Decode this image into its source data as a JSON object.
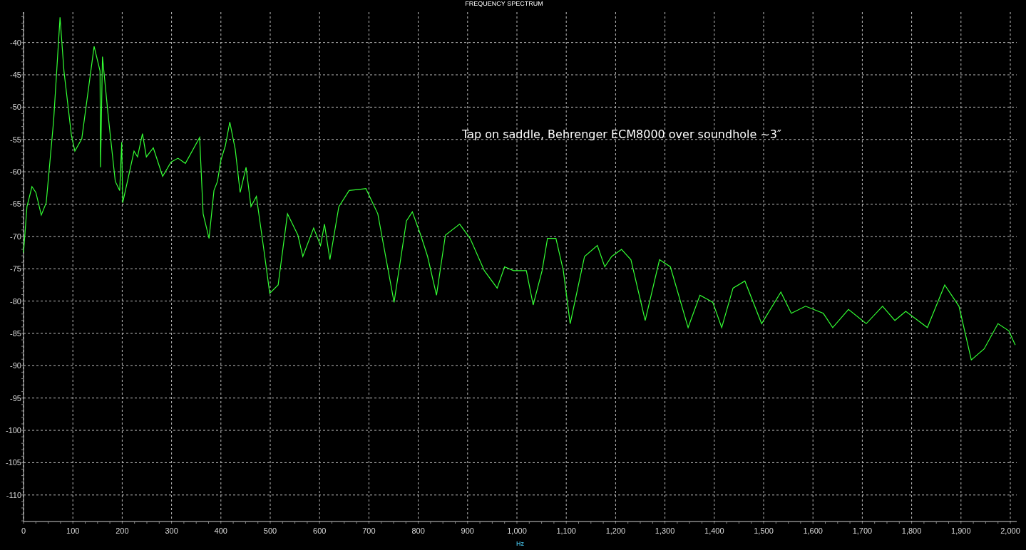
{
  "chart": {
    "chart_data": {
      "type": "line",
      "title": "FREQUENCY SPECTRUM",
      "xlabel": "Hz",
      "x": [
        0,
        7,
        17,
        25,
        36,
        46,
        61,
        74,
        82,
        97,
        104,
        118,
        143,
        155,
        156,
        160,
        172,
        186,
        195,
        199,
        201,
        212,
        224,
        231,
        241,
        249,
        263,
        282,
        299,
        313,
        328,
        357,
        364,
        376,
        386,
        393,
        400,
        409,
        418,
        429,
        439,
        451,
        461,
        472,
        487,
        499,
        516,
        535,
        556,
        566,
        588,
        602,
        610,
        621,
        639,
        660,
        694,
        718,
        751,
        776,
        788,
        805,
        819,
        837,
        855,
        884,
        905,
        934,
        960,
        975,
        993,
        1019,
        1033,
        1051,
        1062,
        1079,
        1094,
        1108,
        1137,
        1163,
        1178,
        1192,
        1212,
        1231,
        1260,
        1289,
        1311,
        1347,
        1371,
        1386,
        1397,
        1415,
        1438,
        1462,
        1496,
        1535,
        1556,
        1585,
        1621,
        1640,
        1672,
        1708,
        1741,
        1766,
        1788,
        1832,
        1867,
        1896,
        1921,
        1947,
        1975,
        1997,
        2010
      ],
      "series": [
        {
          "color": "#33ff33",
          "values": [
            -72.5,
            -65.4,
            -62.3,
            -63.2,
            -66.7,
            -64.8,
            -52.1,
            -36.1,
            -44.4,
            -54.3,
            -56.8,
            -54.9,
            -40.6,
            -44.4,
            -59.3,
            -42.2,
            -51.6,
            -61.5,
            -62.9,
            -55.4,
            -64.8,
            -61,
            -56.8,
            -57.7,
            -54.1,
            -57.7,
            -56.3,
            -60.7,
            -58.5,
            -57.9,
            -58.7,
            -54.7,
            -66.5,
            -70.3,
            -62.9,
            -61.5,
            -58.2,
            -56,
            -52.3,
            -56.5,
            -63.2,
            -59.3,
            -65.4,
            -63.8,
            -72,
            -78.8,
            -77.5,
            -66.5,
            -69.8,
            -73.1,
            -68.7,
            -71.4,
            -68.1,
            -73.6,
            -65.4,
            -62.9,
            -62.6,
            -66.5,
            -80.2,
            -67.6,
            -66.2,
            -69.8,
            -73.1,
            -79.1,
            -69.8,
            -68.1,
            -70.3,
            -75.3,
            -78,
            -74.7,
            -75.3,
            -75.3,
            -80.6,
            -75.3,
            -70.3,
            -70.3,
            -75.3,
            -83.5,
            -73.1,
            -71.4,
            -74.7,
            -73.1,
            -72,
            -73.6,
            -83,
            -73.6,
            -74.7,
            -84.1,
            -79.1,
            -79.7,
            -80.2,
            -84.1,
            -78,
            -76.9,
            -83.5,
            -78.6,
            -81.9,
            -80.8,
            -81.9,
            -84.1,
            -81.3,
            -83.5,
            -80.8,
            -83,
            -81.6,
            -84.1,
            -77.5,
            -80.8,
            -89.1,
            -87.4,
            -83.5,
            -84.6,
            -86.8
          ]
        }
      ],
      "xlim": [
        0,
        2013
      ],
      "ylim": [
        -114.1,
        -35.3
      ],
      "xticks": [
        0,
        100,
        200,
        300,
        400,
        500,
        600,
        700,
        800,
        900,
        {
          "value": 1000,
          "label": "1,000"
        },
        {
          "value": 1100,
          "label": "1,100"
        },
        {
          "value": 1200,
          "label": "1,200"
        },
        {
          "value": 1300,
          "label": "1,300"
        },
        {
          "value": 1400,
          "label": "1,400"
        },
        {
          "value": 1500,
          "label": "1,500"
        },
        {
          "value": 1600,
          "label": "1,600"
        },
        {
          "value": 1700,
          "label": "1,700"
        },
        {
          "value": 1800,
          "label": "1,800"
        },
        {
          "value": 1900,
          "label": "1,900"
        },
        {
          "value": 2000,
          "label": "2,000"
        }
      ],
      "yticks": [
        -40,
        -45,
        -50,
        -55,
        -60,
        -65,
        -70,
        -75,
        -80,
        -85,
        -90,
        -95,
        -100,
        -105,
        -110
      ],
      "grid": true,
      "annotations": [
        "Tap on saddle, Behrenger ECM8000 over soundhole ~3″"
      ]
    }
  }
}
